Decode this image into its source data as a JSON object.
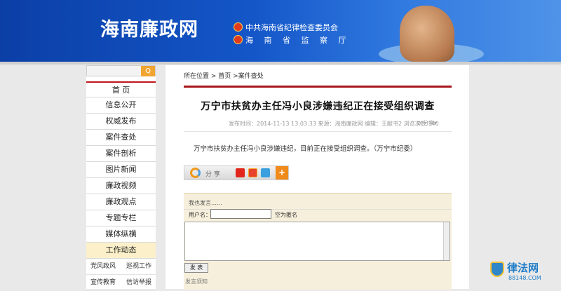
{
  "header": {
    "site_title": "海南廉政网",
    "org1": "中共海南省纪律检查委员会",
    "org2": "海 南 省 监 察 厅"
  },
  "search": {
    "button_icon": "search-icon",
    "placeholder": ""
  },
  "sidebar": {
    "items": [
      {
        "label": "首 页"
      },
      {
        "label": "信息公开"
      },
      {
        "label": "权威发布"
      },
      {
        "label": "案件查处"
      },
      {
        "label": "案件剖析"
      },
      {
        "label": "图片新闻"
      },
      {
        "label": "廉政视频"
      },
      {
        "label": "廉政观点"
      },
      {
        "label": "专题专栏"
      },
      {
        "label": "媒体纵横"
      },
      {
        "label": "工作动态"
      }
    ],
    "sub_rows": [
      [
        "党风政风",
        "巡视工作"
      ],
      [
        "宣传教育",
        "信访举报"
      ]
    ]
  },
  "breadcrumb": {
    "prefix": "所在位置",
    "home": "首页",
    "current": ">案件查处"
  },
  "article": {
    "title": "万宁市扶贫办主任冯小良涉嫌违纪正在接受组织调查",
    "meta": "发布时间：2014-11-13 13:03:33 来源：海南廉政网    编辑：王献书2 浏览次数:140",
    "share_label": "分享",
    "body": "万宁市扶贫办主任冯小良涉嫌违纪，目前正在接受组织调查。（万宁市纪委）"
  },
  "sharebar": {
    "label": "分 享",
    "plus": "+"
  },
  "comment": {
    "title": "我也发言……",
    "username_label": "用户名：",
    "username_value": "",
    "anon_label": "空为匿名",
    "submit_label": "发 表",
    "rules_label": "发言须知"
  },
  "watermark": {
    "text": "律法网",
    "url": "88148.COM"
  },
  "colors": {
    "banner": "#1456c8",
    "accent_red": "#a8161b",
    "search_btn": "#f0a530",
    "dynamic_bg": "#fbf0c9"
  }
}
